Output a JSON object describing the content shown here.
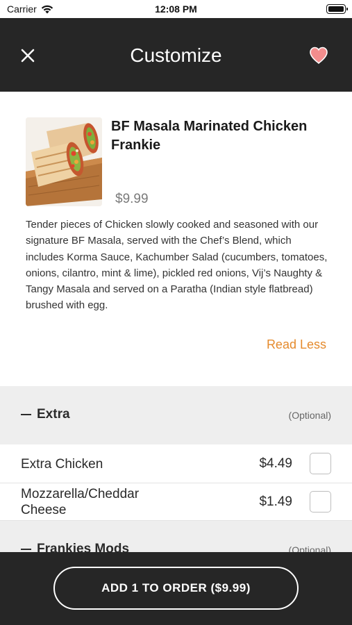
{
  "status_bar": {
    "carrier": "Carrier",
    "time": "12:08 PM",
    "wifi_icon": "wifi-icon",
    "battery_icon": "battery-icon"
  },
  "nav": {
    "title": "Customize",
    "close_icon": "close-icon",
    "favorite_icon": "heart-icon",
    "favorite_color": "#f28d8d"
  },
  "product": {
    "name": "BF Masala Marinated Chicken Frankie",
    "price": "$9.99",
    "description": "Tender pieces of Chicken slowly cooked and seasoned with our signature BF Masala, served with the Chef’s Blend, which includes Korma Sauce, Kachumber Salad (cucumbers, tomatoes, onions, cilantro, mint & lime), pickled red onions, Vij’s Naughty & Tangy Masala and served on a Paratha (Indian style flatbread) brushed with egg.",
    "read_less": "Read Less",
    "accent_color": "#e58a2c"
  },
  "sections": [
    {
      "title": "Extra",
      "optional_label": "(Optional)",
      "options": [
        {
          "label": "Extra Chicken",
          "price": "$4.49",
          "checked": false
        },
        {
          "label": "Mozzarella/Cheddar Cheese",
          "price": "$1.49",
          "checked": false
        }
      ]
    },
    {
      "title": "Frankies Mods",
      "optional_label": "(Optional)",
      "options": []
    }
  ],
  "bottom": {
    "order_button": "ADD 1 TO ORDER ($9.99)"
  }
}
